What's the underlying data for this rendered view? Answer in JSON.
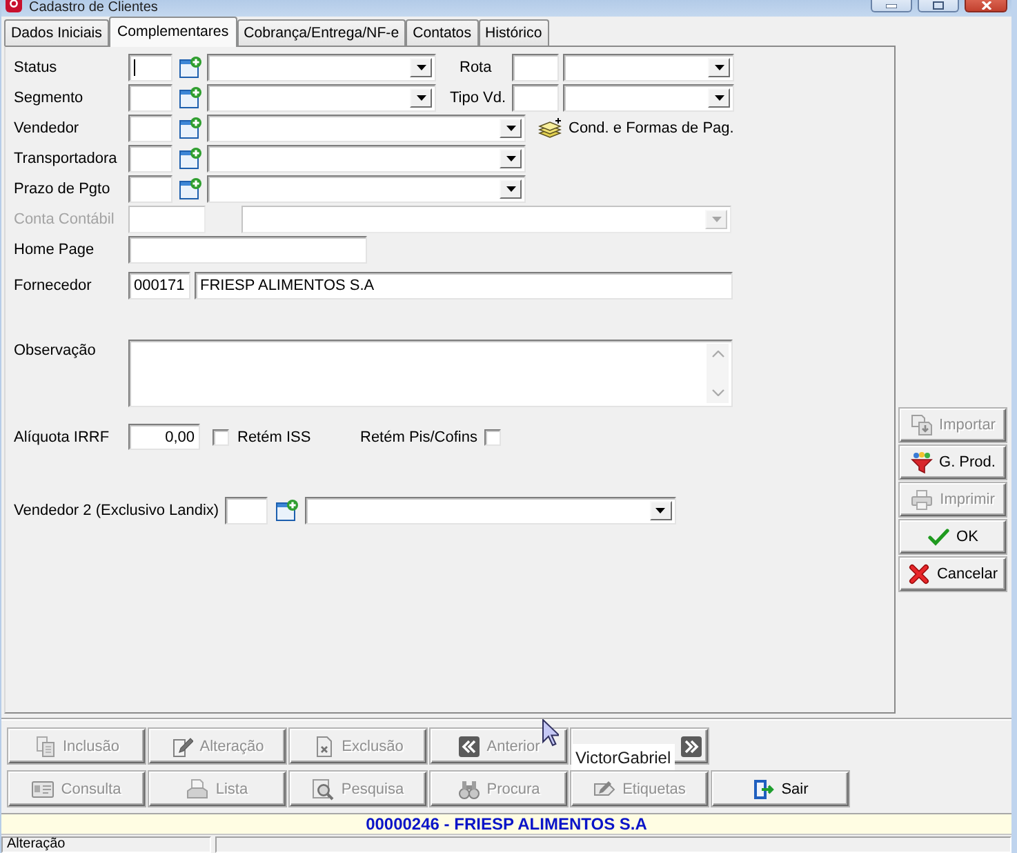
{
  "window": {
    "title": "Cadastro de Clientes"
  },
  "tabs": [
    {
      "label": "Dados Iniciais",
      "selected": false
    },
    {
      "label": "Complementares",
      "selected": true
    },
    {
      "label": "Cobrança/Entrega/NF-e",
      "selected": false
    },
    {
      "label": "Contatos",
      "selected": false
    },
    {
      "label": "Histórico",
      "selected": false
    }
  ],
  "form": {
    "status": {
      "label": "Status",
      "focused": true
    },
    "rota": {
      "label": "Rota"
    },
    "segmento": {
      "label": "Segmento"
    },
    "tipo_vd": {
      "label": "Tipo Vd."
    },
    "vendedor": {
      "label": "Vendedor"
    },
    "cond_pag": {
      "label": "Cond. e Formas de Pag."
    },
    "transportadora": {
      "label": "Transportadora"
    },
    "prazo_pgto": {
      "label": "Prazo de Pgto"
    },
    "conta_contabil": {
      "label": "Conta Contábil",
      "disabled": true
    },
    "home_page": {
      "label": "Home Page"
    },
    "fornecedor": {
      "label": "Fornecedor",
      "code": "000171",
      "name": "FRIESP ALIMENTOS S.A"
    },
    "observacao": {
      "label": "Observação"
    },
    "aliquota_irrf": {
      "label": "Alíquota IRRF",
      "value": "0,00"
    },
    "retem_iss": {
      "label": "Retém ISS",
      "checked": false
    },
    "retem_pis_cofins": {
      "label": "Retém Pis/Cofins",
      "checked": false
    },
    "vendedor_2": {
      "label": "Vendedor 2 (Exclusivo Landix)"
    }
  },
  "side_buttons": [
    {
      "label": "Importar",
      "disabled": true
    },
    {
      "label": "G. Prod.",
      "disabled": false
    },
    {
      "label": "Imprimir",
      "disabled": true
    },
    {
      "label": "OK",
      "disabled": false
    },
    {
      "label": "Cancelar",
      "disabled": false
    }
  ],
  "nav_buttons": [
    [
      {
        "label": "Inclusão",
        "disabled": true
      },
      {
        "label": "Alteração",
        "disabled": true
      },
      {
        "label": "Exclusão",
        "disabled": true
      },
      {
        "label": "Anterior",
        "disabled": true
      },
      {
        "disabled": true
      }
    ],
    [
      {
        "label": "Consulta",
        "disabled": true
      },
      {
        "label": "Lista",
        "disabled": true
      },
      {
        "label": "Pesquisa",
        "disabled": true
      },
      {
        "label": "Procura",
        "disabled": true
      },
      {
        "label": "Etiquetas",
        "disabled": true
      },
      {
        "label": "Sair",
        "disabled": false
      }
    ]
  ],
  "tooltip": {
    "text": "VictorGabriel"
  },
  "record_bar": {
    "text": "00000246 - FRIESP ALIMENTOS S.A"
  },
  "status_bar": {
    "mode": "Alteração"
  }
}
